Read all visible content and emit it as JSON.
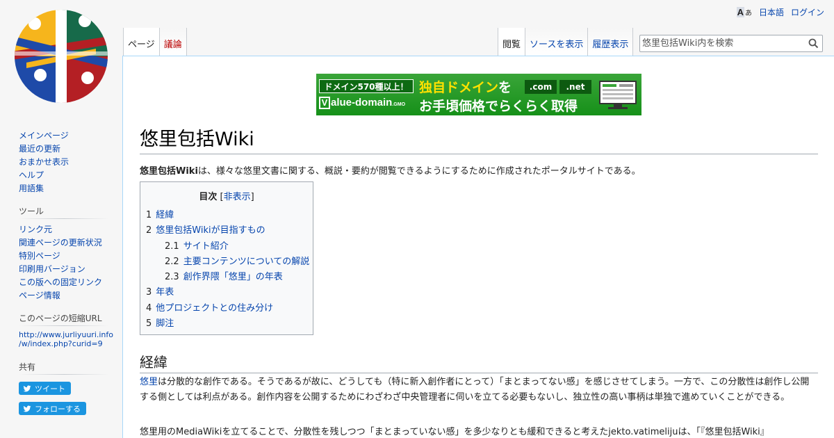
{
  "personal": {
    "language": "日本語",
    "login": "ログイン",
    "lang_icon_a": "A",
    "lang_icon_b": "あ"
  },
  "tabs_left": [
    "ページ",
    "議論"
  ],
  "tabs_right": [
    "閲覧",
    "ソースを表示",
    "履歴表示"
  ],
  "search": {
    "placeholder": "悠里包括Wiki内を検索"
  },
  "sidebar": {
    "nav": [
      "メインページ",
      "最近の更新",
      "おまかせ表示",
      "ヘルプ",
      "用語集"
    ],
    "tools_heading": "ツール",
    "tools": [
      "リンク元",
      "関連ページの更新状況",
      "特別ページ",
      "印刷用バージョン",
      "この版への固定リンク",
      "ページ情報"
    ],
    "short_heading": "このページの短縮URL",
    "short_url_1": "http://www.jurliyuuri.info",
    "short_url_2": "/w/index.php?curid=9",
    "share_heading": "共有",
    "share_tweet": "ツイート",
    "share_follow": "フォローする"
  },
  "banner": {
    "badge": "ドメイン570種以上！",
    "headline_1": "独自ドメイン",
    "headline_2": "を",
    "tld_1": ".com",
    "tld_2": ".net",
    "brand": "alue-domain",
    "brand_v": "V",
    "brand_suffix": ".GMO",
    "sub": "お手頃価格でらくらく取得"
  },
  "page": {
    "title": "悠里包括Wiki",
    "intro_bold": "悠里包括Wiki",
    "intro_rest": "は、様々な悠里文書に関する、概説・要約が閲覧できるようにするために作成されたポータルサイトである。"
  },
  "toc": {
    "title": "目次",
    "toggle_open": "[",
    "toggle": "非表示",
    "toggle_close": "]",
    "items": [
      {
        "num": "1",
        "label": "経緯",
        "level": 1
      },
      {
        "num": "2",
        "label": "悠里包括Wikiが目指すもの",
        "level": 1
      },
      {
        "num": "2.1",
        "label": "サイト紹介",
        "level": 2
      },
      {
        "num": "2.2",
        "label": "主要コンテンツについての解説",
        "level": 2
      },
      {
        "num": "2.3",
        "label": "創作界隈「悠里」の年表",
        "level": 2
      },
      {
        "num": "3",
        "label": "年表",
        "level": 1
      },
      {
        "num": "4",
        "label": "他プロジェクトとの住み分け",
        "level": 1
      },
      {
        "num": "5",
        "label": "脚注",
        "level": 1
      }
    ]
  },
  "section": {
    "heading": "経緯",
    "p1_link": "悠里",
    "p1_rest": "は分散的な創作である。そうであるが故に、どうしても（特に新入創作者にとって）「まとまってない感」を感じさせてしまう。一方で、この分散性は創作し公開する側としては利点がある。創作内容を公開するためにわざわざ中央管理者に伺いを立てる必要もないし、独立性の高い事柄は単独で進めていくことができる。",
    "p2": "悠里用のMediaWikiを立てることで、分散性を残しつつ「まとまっていない感」を多少なりとも緩和できると考えたjekto.vatimelijuは、「『悠里包括Wiki』"
  },
  "colors": {
    "link": "#0645ad",
    "new_link": "#ba0000",
    "banner_green": "#1e9a1f",
    "banner_yellow": "#ffe100",
    "twitter": "#1b95e0"
  }
}
